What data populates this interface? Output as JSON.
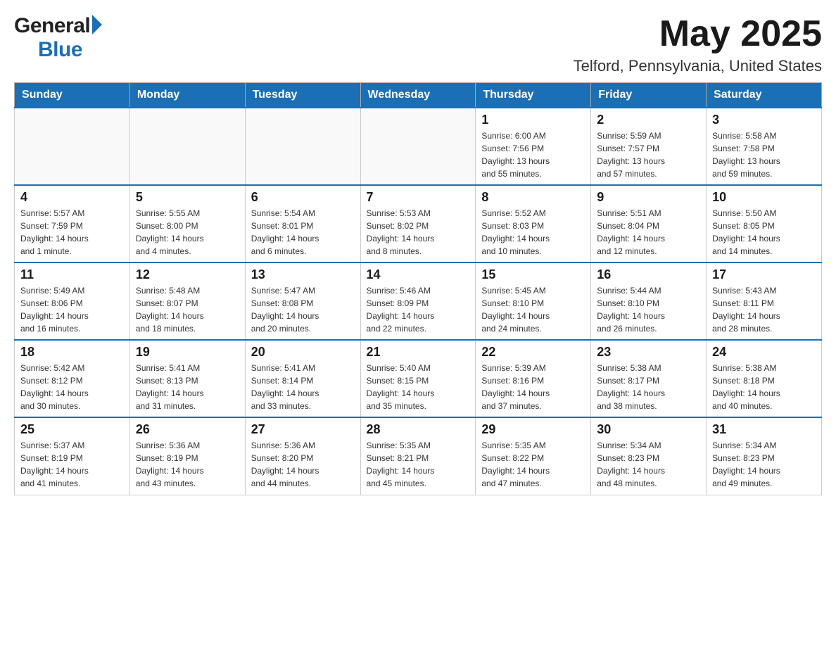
{
  "header": {
    "logo_general": "General",
    "logo_blue": "Blue",
    "month_title": "May 2025",
    "location": "Telford, Pennsylvania, United States"
  },
  "days_of_week": [
    "Sunday",
    "Monday",
    "Tuesday",
    "Wednesday",
    "Thursday",
    "Friday",
    "Saturday"
  ],
  "weeks": [
    {
      "days": [
        {
          "num": "",
          "info": ""
        },
        {
          "num": "",
          "info": ""
        },
        {
          "num": "",
          "info": ""
        },
        {
          "num": "",
          "info": ""
        },
        {
          "num": "1",
          "info": "Sunrise: 6:00 AM\nSunset: 7:56 PM\nDaylight: 13 hours\nand 55 minutes."
        },
        {
          "num": "2",
          "info": "Sunrise: 5:59 AM\nSunset: 7:57 PM\nDaylight: 13 hours\nand 57 minutes."
        },
        {
          "num": "3",
          "info": "Sunrise: 5:58 AM\nSunset: 7:58 PM\nDaylight: 13 hours\nand 59 minutes."
        }
      ]
    },
    {
      "days": [
        {
          "num": "4",
          "info": "Sunrise: 5:57 AM\nSunset: 7:59 PM\nDaylight: 14 hours\nand 1 minute."
        },
        {
          "num": "5",
          "info": "Sunrise: 5:55 AM\nSunset: 8:00 PM\nDaylight: 14 hours\nand 4 minutes."
        },
        {
          "num": "6",
          "info": "Sunrise: 5:54 AM\nSunset: 8:01 PM\nDaylight: 14 hours\nand 6 minutes."
        },
        {
          "num": "7",
          "info": "Sunrise: 5:53 AM\nSunset: 8:02 PM\nDaylight: 14 hours\nand 8 minutes."
        },
        {
          "num": "8",
          "info": "Sunrise: 5:52 AM\nSunset: 8:03 PM\nDaylight: 14 hours\nand 10 minutes."
        },
        {
          "num": "9",
          "info": "Sunrise: 5:51 AM\nSunset: 8:04 PM\nDaylight: 14 hours\nand 12 minutes."
        },
        {
          "num": "10",
          "info": "Sunrise: 5:50 AM\nSunset: 8:05 PM\nDaylight: 14 hours\nand 14 minutes."
        }
      ]
    },
    {
      "days": [
        {
          "num": "11",
          "info": "Sunrise: 5:49 AM\nSunset: 8:06 PM\nDaylight: 14 hours\nand 16 minutes."
        },
        {
          "num": "12",
          "info": "Sunrise: 5:48 AM\nSunset: 8:07 PM\nDaylight: 14 hours\nand 18 minutes."
        },
        {
          "num": "13",
          "info": "Sunrise: 5:47 AM\nSunset: 8:08 PM\nDaylight: 14 hours\nand 20 minutes."
        },
        {
          "num": "14",
          "info": "Sunrise: 5:46 AM\nSunset: 8:09 PM\nDaylight: 14 hours\nand 22 minutes."
        },
        {
          "num": "15",
          "info": "Sunrise: 5:45 AM\nSunset: 8:10 PM\nDaylight: 14 hours\nand 24 minutes."
        },
        {
          "num": "16",
          "info": "Sunrise: 5:44 AM\nSunset: 8:10 PM\nDaylight: 14 hours\nand 26 minutes."
        },
        {
          "num": "17",
          "info": "Sunrise: 5:43 AM\nSunset: 8:11 PM\nDaylight: 14 hours\nand 28 minutes."
        }
      ]
    },
    {
      "days": [
        {
          "num": "18",
          "info": "Sunrise: 5:42 AM\nSunset: 8:12 PM\nDaylight: 14 hours\nand 30 minutes."
        },
        {
          "num": "19",
          "info": "Sunrise: 5:41 AM\nSunset: 8:13 PM\nDaylight: 14 hours\nand 31 minutes."
        },
        {
          "num": "20",
          "info": "Sunrise: 5:41 AM\nSunset: 8:14 PM\nDaylight: 14 hours\nand 33 minutes."
        },
        {
          "num": "21",
          "info": "Sunrise: 5:40 AM\nSunset: 8:15 PM\nDaylight: 14 hours\nand 35 minutes."
        },
        {
          "num": "22",
          "info": "Sunrise: 5:39 AM\nSunset: 8:16 PM\nDaylight: 14 hours\nand 37 minutes."
        },
        {
          "num": "23",
          "info": "Sunrise: 5:38 AM\nSunset: 8:17 PM\nDaylight: 14 hours\nand 38 minutes."
        },
        {
          "num": "24",
          "info": "Sunrise: 5:38 AM\nSunset: 8:18 PM\nDaylight: 14 hours\nand 40 minutes."
        }
      ]
    },
    {
      "days": [
        {
          "num": "25",
          "info": "Sunrise: 5:37 AM\nSunset: 8:19 PM\nDaylight: 14 hours\nand 41 minutes."
        },
        {
          "num": "26",
          "info": "Sunrise: 5:36 AM\nSunset: 8:19 PM\nDaylight: 14 hours\nand 43 minutes."
        },
        {
          "num": "27",
          "info": "Sunrise: 5:36 AM\nSunset: 8:20 PM\nDaylight: 14 hours\nand 44 minutes."
        },
        {
          "num": "28",
          "info": "Sunrise: 5:35 AM\nSunset: 8:21 PM\nDaylight: 14 hours\nand 45 minutes."
        },
        {
          "num": "29",
          "info": "Sunrise: 5:35 AM\nSunset: 8:22 PM\nDaylight: 14 hours\nand 47 minutes."
        },
        {
          "num": "30",
          "info": "Sunrise: 5:34 AM\nSunset: 8:23 PM\nDaylight: 14 hours\nand 48 minutes."
        },
        {
          "num": "31",
          "info": "Sunrise: 5:34 AM\nSunset: 8:23 PM\nDaylight: 14 hours\nand 49 minutes."
        }
      ]
    }
  ]
}
